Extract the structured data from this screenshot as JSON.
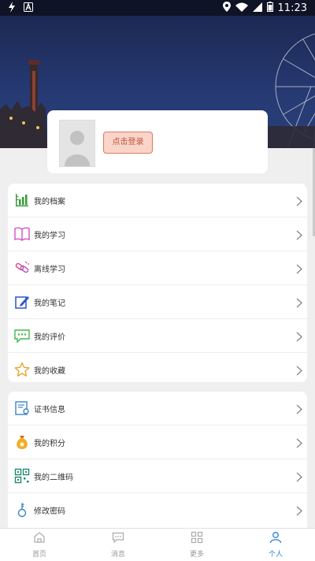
{
  "status_bar": {
    "time": "11:23",
    "icons": [
      "bolt-icon",
      "a-badge-icon",
      "location-icon",
      "wifi-icon",
      "signal-icon",
      "battery-icon"
    ]
  },
  "profile": {
    "login_label": "点击登录"
  },
  "menu_group_1": [
    {
      "name": "archive",
      "label": "我的档案",
      "icon": "bar-chart-icon",
      "color": "#3a9a3a"
    },
    {
      "name": "study",
      "label": "我的学习",
      "icon": "book-icon",
      "color": "#d64fc8"
    },
    {
      "name": "offline-study",
      "label": "离线学习",
      "icon": "offline-link-icon",
      "color": "#e0457a"
    },
    {
      "name": "notes",
      "label": "我的笔记",
      "icon": "note-edit-icon",
      "color": "#2b56c9"
    },
    {
      "name": "reviews",
      "label": "我的评价",
      "icon": "comment-icon",
      "color": "#3db84c"
    },
    {
      "name": "favorites",
      "label": "我的收藏",
      "icon": "star-icon",
      "color": "#e8a52b"
    }
  ],
  "menu_group_2": [
    {
      "name": "certificate",
      "label": "证书信息",
      "icon": "certificate-icon",
      "color": "#3b86c9"
    },
    {
      "name": "points",
      "label": "我的积分",
      "icon": "money-bag-icon",
      "color": "#e49a1a"
    },
    {
      "name": "qrcode",
      "label": "我的二维码",
      "icon": "qr-code-icon",
      "color": "#1f8a6e"
    },
    {
      "name": "password",
      "label": "修改密码",
      "icon": "key-icon",
      "color": "#3b86c9"
    }
  ],
  "tabs": [
    {
      "name": "home",
      "label": "首页",
      "icon": "home-icon",
      "active": false
    },
    {
      "name": "messages",
      "label": "消息",
      "icon": "message-icon",
      "active": false
    },
    {
      "name": "more",
      "label": "更多",
      "icon": "grid-icon",
      "active": false
    },
    {
      "name": "profile",
      "label": "个人",
      "icon": "person-icon",
      "active": true
    }
  ],
  "colors": {
    "accent": "#2b7fd4",
    "login_bg": "#f9d4c8",
    "login_border": "#e07a62",
    "login_text": "#c2523a"
  }
}
